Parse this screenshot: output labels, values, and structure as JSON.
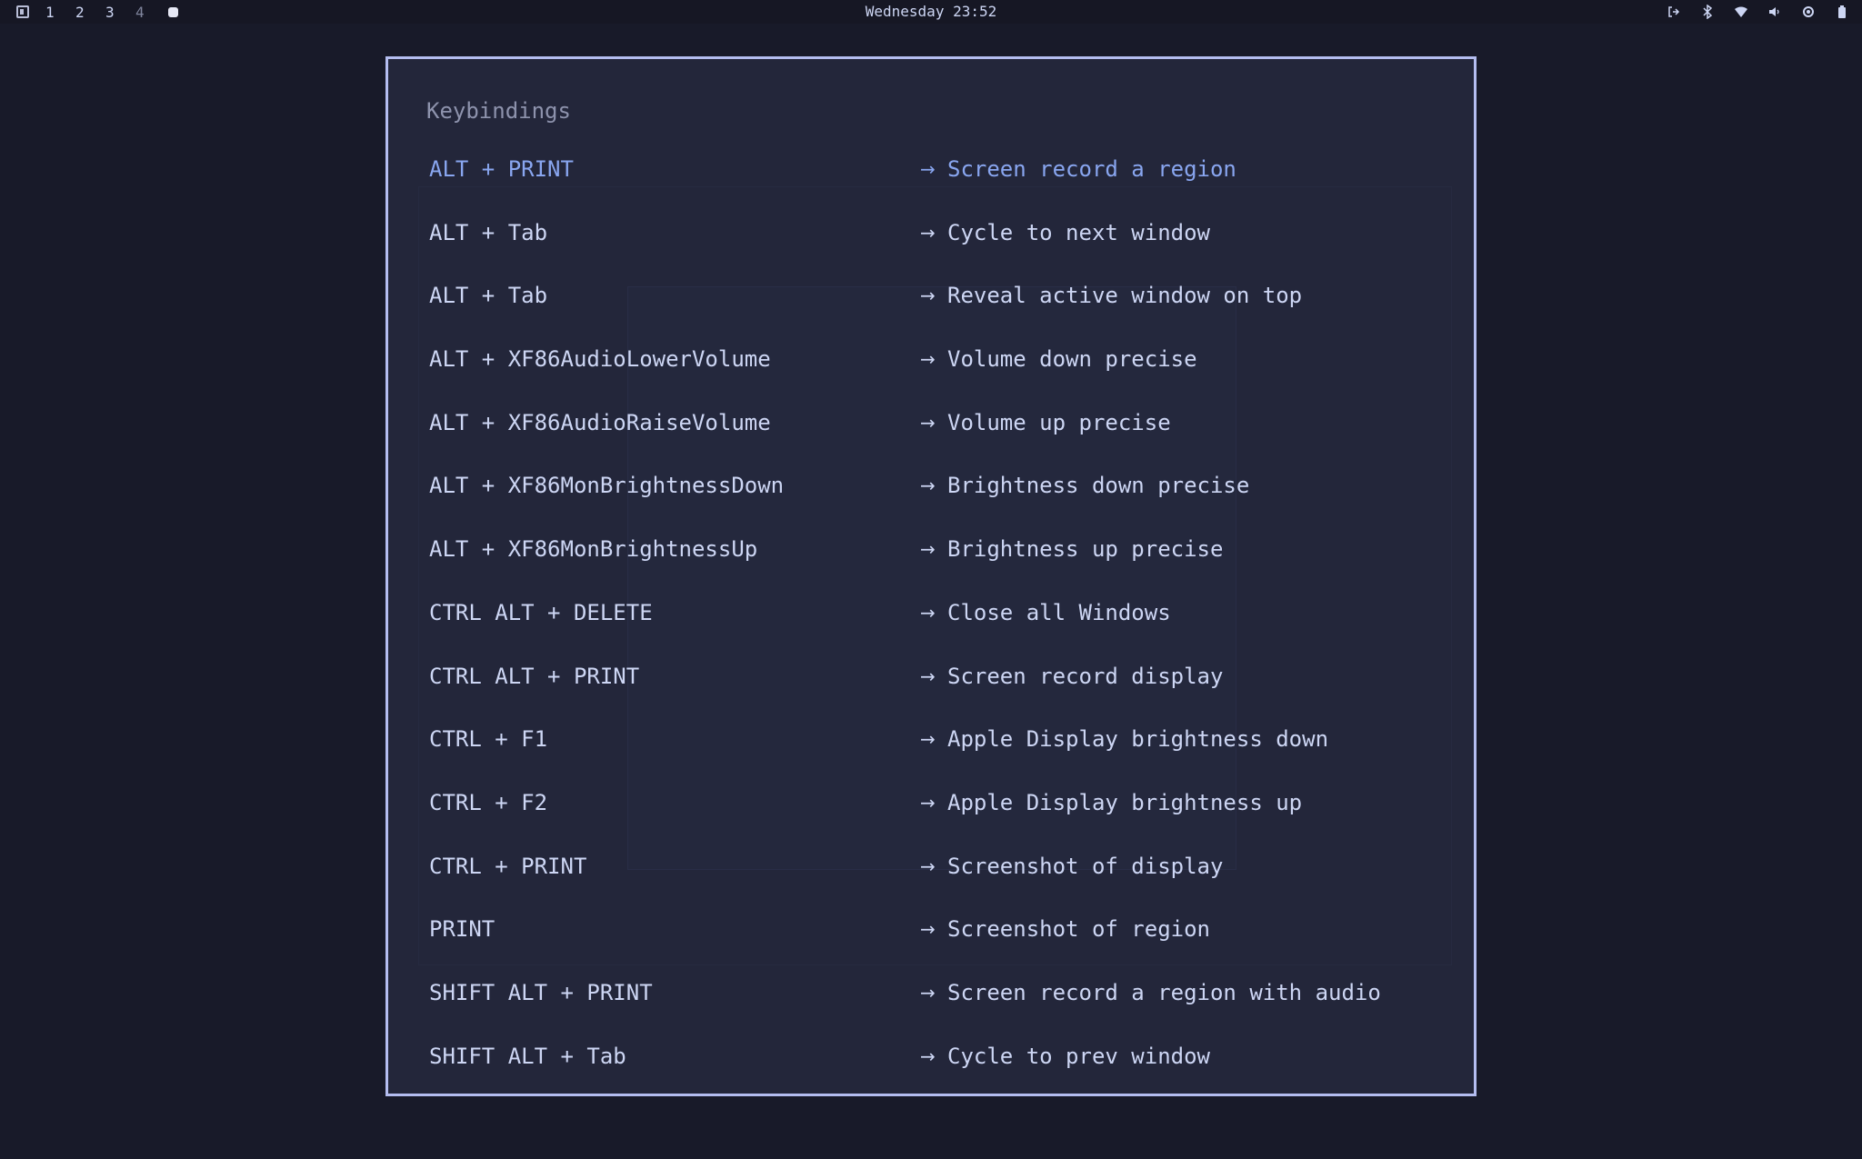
{
  "topbar": {
    "workspaces": [
      "1",
      "2",
      "3",
      "4"
    ],
    "clock": "Wednesday 23:52",
    "tray_icons": [
      "logout-icon",
      "bluetooth-icon",
      "wifi-icon",
      "volume-icon",
      "settings-icon",
      "battery-icon"
    ]
  },
  "panel": {
    "title": "Keybindings",
    "bindings": [
      {
        "key": "ALT + PRINT",
        "desc": "Screen record a region"
      },
      {
        "key": "ALT + Tab",
        "desc": "Cycle to next window"
      },
      {
        "key": "ALT + Tab",
        "desc": "Reveal active window on top"
      },
      {
        "key": "ALT + XF86AudioLowerVolume",
        "desc": "Volume down precise"
      },
      {
        "key": "ALT + XF86AudioRaiseVolume",
        "desc": "Volume up precise"
      },
      {
        "key": "ALT + XF86MonBrightnessDown",
        "desc": "Brightness down precise"
      },
      {
        "key": "ALT + XF86MonBrightnessUp",
        "desc": "Brightness up precise"
      },
      {
        "key": "CTRL ALT + DELETE",
        "desc": "Close all Windows"
      },
      {
        "key": "CTRL ALT + PRINT",
        "desc": "Screen record display"
      },
      {
        "key": "CTRL + F1",
        "desc": "Apple Display brightness down"
      },
      {
        "key": "CTRL + F2",
        "desc": "Apple Display brightness up"
      },
      {
        "key": "CTRL + PRINT",
        "desc": "Screenshot of display"
      },
      {
        "key": "PRINT",
        "desc": "Screenshot of region"
      },
      {
        "key": "SHIFT ALT + PRINT",
        "desc": "Screen record a region with audio"
      },
      {
        "key": "SHIFT ALT + Tab",
        "desc": "Cycle to prev window"
      }
    ],
    "arrow": "→",
    "colors": {
      "accent": "#89a6f0",
      "border": "#b4bdf0",
      "text": "#cdd6f4"
    }
  }
}
